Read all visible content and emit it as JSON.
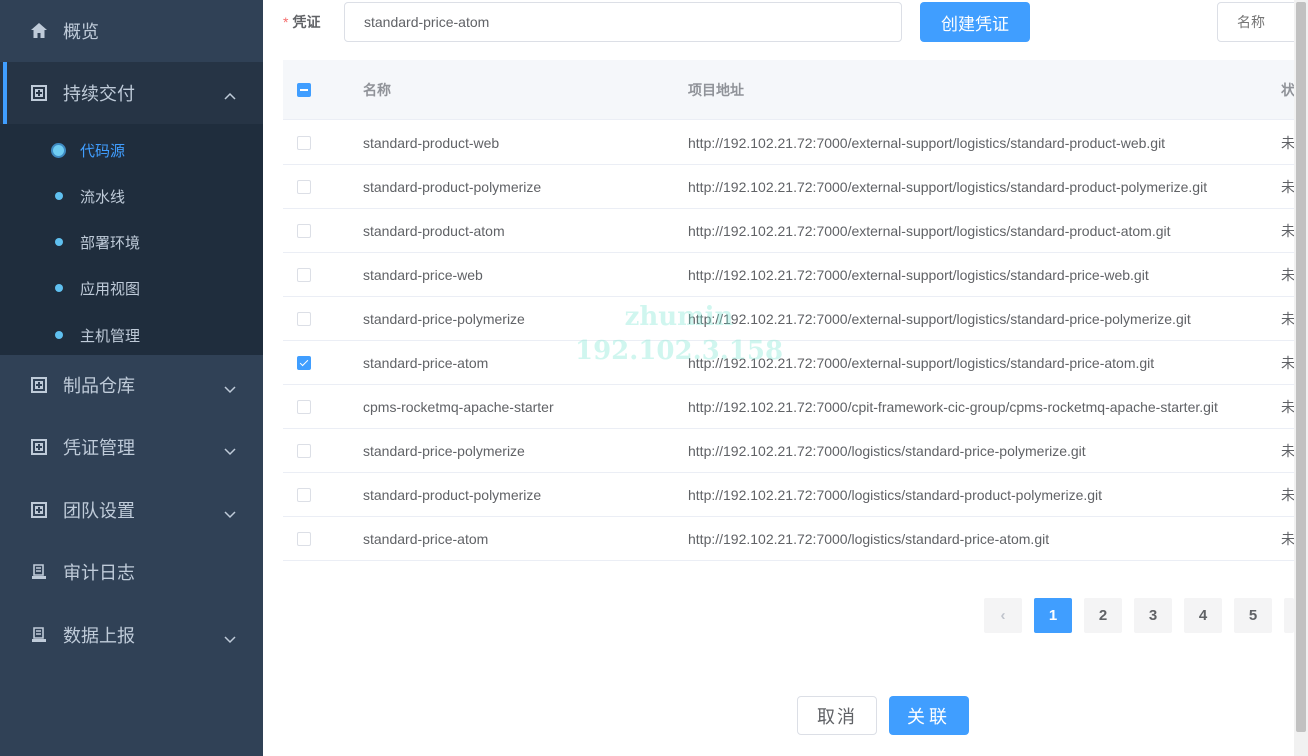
{
  "sidebar": {
    "items": [
      {
        "label": "概览",
        "icon": "home-icon"
      },
      {
        "label": "持续交付",
        "icon": "grid-icon",
        "expanded": true
      },
      {
        "label": "制品仓库",
        "icon": "grid-icon"
      },
      {
        "label": "凭证管理",
        "icon": "grid-icon"
      },
      {
        "label": "团队设置",
        "icon": "grid-icon"
      },
      {
        "label": "审计日志",
        "icon": "document-icon"
      },
      {
        "label": "数据上报",
        "icon": "document-icon"
      }
    ],
    "subitems": [
      {
        "label": "代码源",
        "active": true
      },
      {
        "label": "流水线"
      },
      {
        "label": "部署环境"
      },
      {
        "label": "应用视图"
      },
      {
        "label": "主机管理"
      }
    ]
  },
  "form": {
    "required_mark": "*",
    "credential_label": "凭证",
    "credential_value": "standard-price-atom",
    "create_button": "创建凭证",
    "name_placeholder": "名称"
  },
  "table": {
    "headers": {
      "name": "名称",
      "url": "项目地址",
      "status": "状"
    },
    "rows": [
      {
        "name": "standard-product-web",
        "url": "http://192.102.21.72:7000/external-support/logistics/standard-product-web.git",
        "status": "未",
        "checked": false
      },
      {
        "name": "standard-product-polymerize",
        "url": "http://192.102.21.72:7000/external-support/logistics/standard-product-polymerize.git",
        "status": "未",
        "checked": false
      },
      {
        "name": "standard-product-atom",
        "url": "http://192.102.21.72:7000/external-support/logistics/standard-product-atom.git",
        "status": "未",
        "checked": false
      },
      {
        "name": "standard-price-web",
        "url": "http://192.102.21.72:7000/external-support/logistics/standard-price-web.git",
        "status": "未",
        "checked": false
      },
      {
        "name": "standard-price-polymerize",
        "url": "http://192.102.21.72:7000/external-support/logistics/standard-price-polymerize.git",
        "status": "未",
        "checked": false
      },
      {
        "name": "standard-price-atom",
        "url": "http://192.102.21.72:7000/external-support/logistics/standard-price-atom.git",
        "status": "未",
        "checked": true
      },
      {
        "name": "cpms-rocketmq-apache-starter",
        "url": "http://192.102.21.72:7000/cpit-framework-cic-group/cpms-rocketmq-apache-starter.git",
        "status": "未",
        "checked": false
      },
      {
        "name": "standard-price-polymerize",
        "url": "http://192.102.21.72:7000/logistics/standard-price-polymerize.git",
        "status": "未",
        "checked": false
      },
      {
        "name": "standard-product-polymerize",
        "url": "http://192.102.21.72:7000/logistics/standard-product-polymerize.git",
        "status": "未",
        "checked": false
      },
      {
        "name": "standard-price-atom",
        "url": "http://192.102.21.72:7000/logistics/standard-price-atom.git",
        "status": "未",
        "checked": false
      }
    ]
  },
  "watermark": {
    "line1": "zhumin",
    "line2": "192.102.3.158"
  },
  "pagination": {
    "prev": "‹",
    "pages": [
      "1",
      "2",
      "3",
      "4",
      "5"
    ],
    "current": "1"
  },
  "footer": {
    "cancel": "取消",
    "confirm": "关联"
  },
  "colors": {
    "primary": "#409eff",
    "sidebar_bg": "#304156",
    "submenu_bg": "#1f2d3d"
  }
}
